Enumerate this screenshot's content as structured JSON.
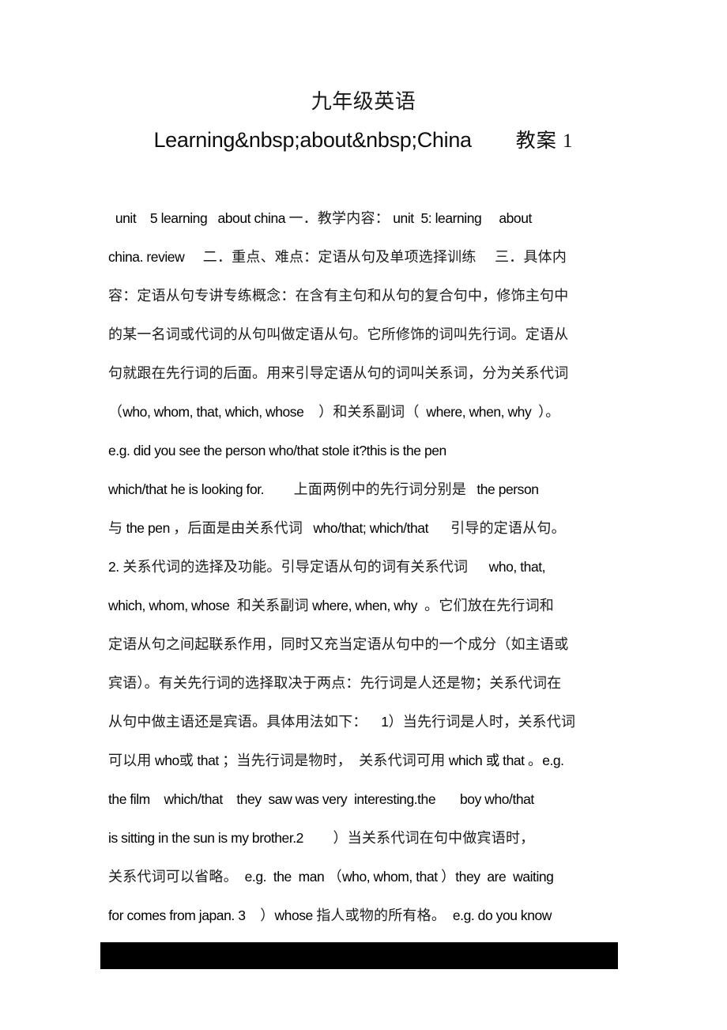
{
  "document": {
    "title_line_1": "九年级英语",
    "title_line_2_latin": "Learning&nbsp;about&nbsp;China",
    "title_line_2_cjk": "教案 1",
    "lines": [
      [
        {
          "t": "  unit    5 learning   about china ",
          "s": "lat"
        },
        {
          "t": "一．教学内容：",
          "s": "cjk"
        },
        {
          "t": " unit  5: learning     about",
          "s": "lat"
        }
      ],
      [
        {
          "t": "china. review",
          "s": "lat"
        },
        {
          "t": "     二．重点、难点：定语从句及单项选择训练     三．具体内",
          "s": "cjk"
        }
      ],
      [
        {
          "t": "容：定语从句专讲专练概念：在含有主句和从句的复合句中，修饰主句中",
          "s": "cjk"
        }
      ],
      [
        {
          "t": "的某一名词或代词的从句叫做定语从句。它所修饰的词叫先行词。定语从",
          "s": "cjk"
        }
      ],
      [
        {
          "t": "句就跟在先行词的后面。用来引导定语从句的词叫关系词，分为关系代词",
          "s": "cjk"
        }
      ],
      [
        {
          "t": "（",
          "s": "cjk"
        },
        {
          "t": "who, whom, that, which, whose",
          "s": "lat"
        },
        {
          "t": "    ）和关系副词（",
          "s": "cjk"
        },
        {
          "t": "  where, when, why  ",
          "s": "lat"
        },
        {
          "t": "）。",
          "s": "cjk"
        }
      ],
      [
        {
          "t": "e.g. did you see the person who/that stole it?this is the pen",
          "s": "lat"
        }
      ],
      [
        {
          "t": "which/that he is looking for.",
          "s": "lat"
        },
        {
          "t": "        上面两例中的先行词分别是",
          "s": "cjk"
        },
        {
          "t": "   the person",
          "s": "lat"
        }
      ],
      [
        {
          "t": "与",
          "s": "cjk"
        },
        {
          "t": " the pen ",
          "s": "lat"
        },
        {
          "t": "，后面是由关系代词",
          "s": "cjk"
        },
        {
          "t": "   who/that; which/that",
          "s": "lat"
        },
        {
          "t": "      引导的定语从句。",
          "s": "cjk"
        }
      ],
      [
        {
          "t": "2.",
          "s": "lat"
        },
        {
          "t": " 关系代词的选择及功能。引导定语从句的词有关系代词",
          "s": "cjk"
        },
        {
          "t": "      who, that,",
          "s": "lat"
        }
      ],
      [
        {
          "t": "which, whom, whose",
          "s": "lat"
        },
        {
          "t": "  和关系副词",
          "s": "cjk"
        },
        {
          "t": " where, when, why ",
          "s": "lat"
        },
        {
          "t": " 。它们放在先行词和",
          "s": "cjk"
        }
      ],
      [
        {
          "t": "定语从句之间起联系作用，同时又充当定语从句中的一个成分（如主语或",
          "s": "cjk"
        }
      ],
      [
        {
          "t": "宾语）。有关先行词的选择取决于两点：先行词是人还是物；关系代词在",
          "s": "cjk"
        }
      ],
      [
        {
          "t": "从句中做主语还是宾语。具体用法如下：",
          "s": "cjk"
        },
        {
          "t": "    1",
          "s": "lat"
        },
        {
          "t": "）当先行词是人时，关系代词",
          "s": "cjk"
        }
      ],
      [
        {
          "t": "可以用",
          "s": "cjk"
        },
        {
          "t": " who",
          "s": "lat"
        },
        {
          "t": "或",
          "s": "cjk"
        },
        {
          "t": " that ",
          "s": "lat"
        },
        {
          "t": "；当先行词是物时，　关系代词可用",
          "s": "cjk"
        },
        {
          "t": " which 或 that ",
          "s": "lat"
        },
        {
          "t": "。",
          "s": "cjk"
        },
        {
          "t": "e.g.",
          "s": "lat"
        }
      ],
      [
        {
          "t": "the film    which/that    they  saw was very  interesting.the       boy who/that",
          "s": "lat"
        }
      ],
      [
        {
          "t": "is sitting in the sun is my brother.2",
          "s": "lat"
        },
        {
          "t": "        ）当关系代词在句中做宾语时，",
          "s": "cjk"
        }
      ],
      [
        {
          "t": "关系代词可以省略。",
          "s": "cjk"
        },
        {
          "t": "  e.g.  the  man ",
          "s": "lat"
        },
        {
          "t": "（",
          "s": "cjk"
        },
        {
          "t": "who, whom, that ",
          "s": "lat"
        },
        {
          "t": "）",
          "s": "cjk"
        },
        {
          "t": "they  are  waiting",
          "s": "lat"
        }
      ],
      [
        {
          "t": "for comes from japan. 3",
          "s": "lat"
        },
        {
          "t": "    ）",
          "s": "cjk"
        },
        {
          "t": "whose ",
          "s": "lat"
        },
        {
          "t": "指人或物的所有格。",
          "s": "cjk"
        },
        {
          "t": "  e.g. do you know",
          "s": "lat"
        }
      ]
    ],
    "redaction_bar": {
      "color": "#000000",
      "label": "redacted-content"
    }
  }
}
